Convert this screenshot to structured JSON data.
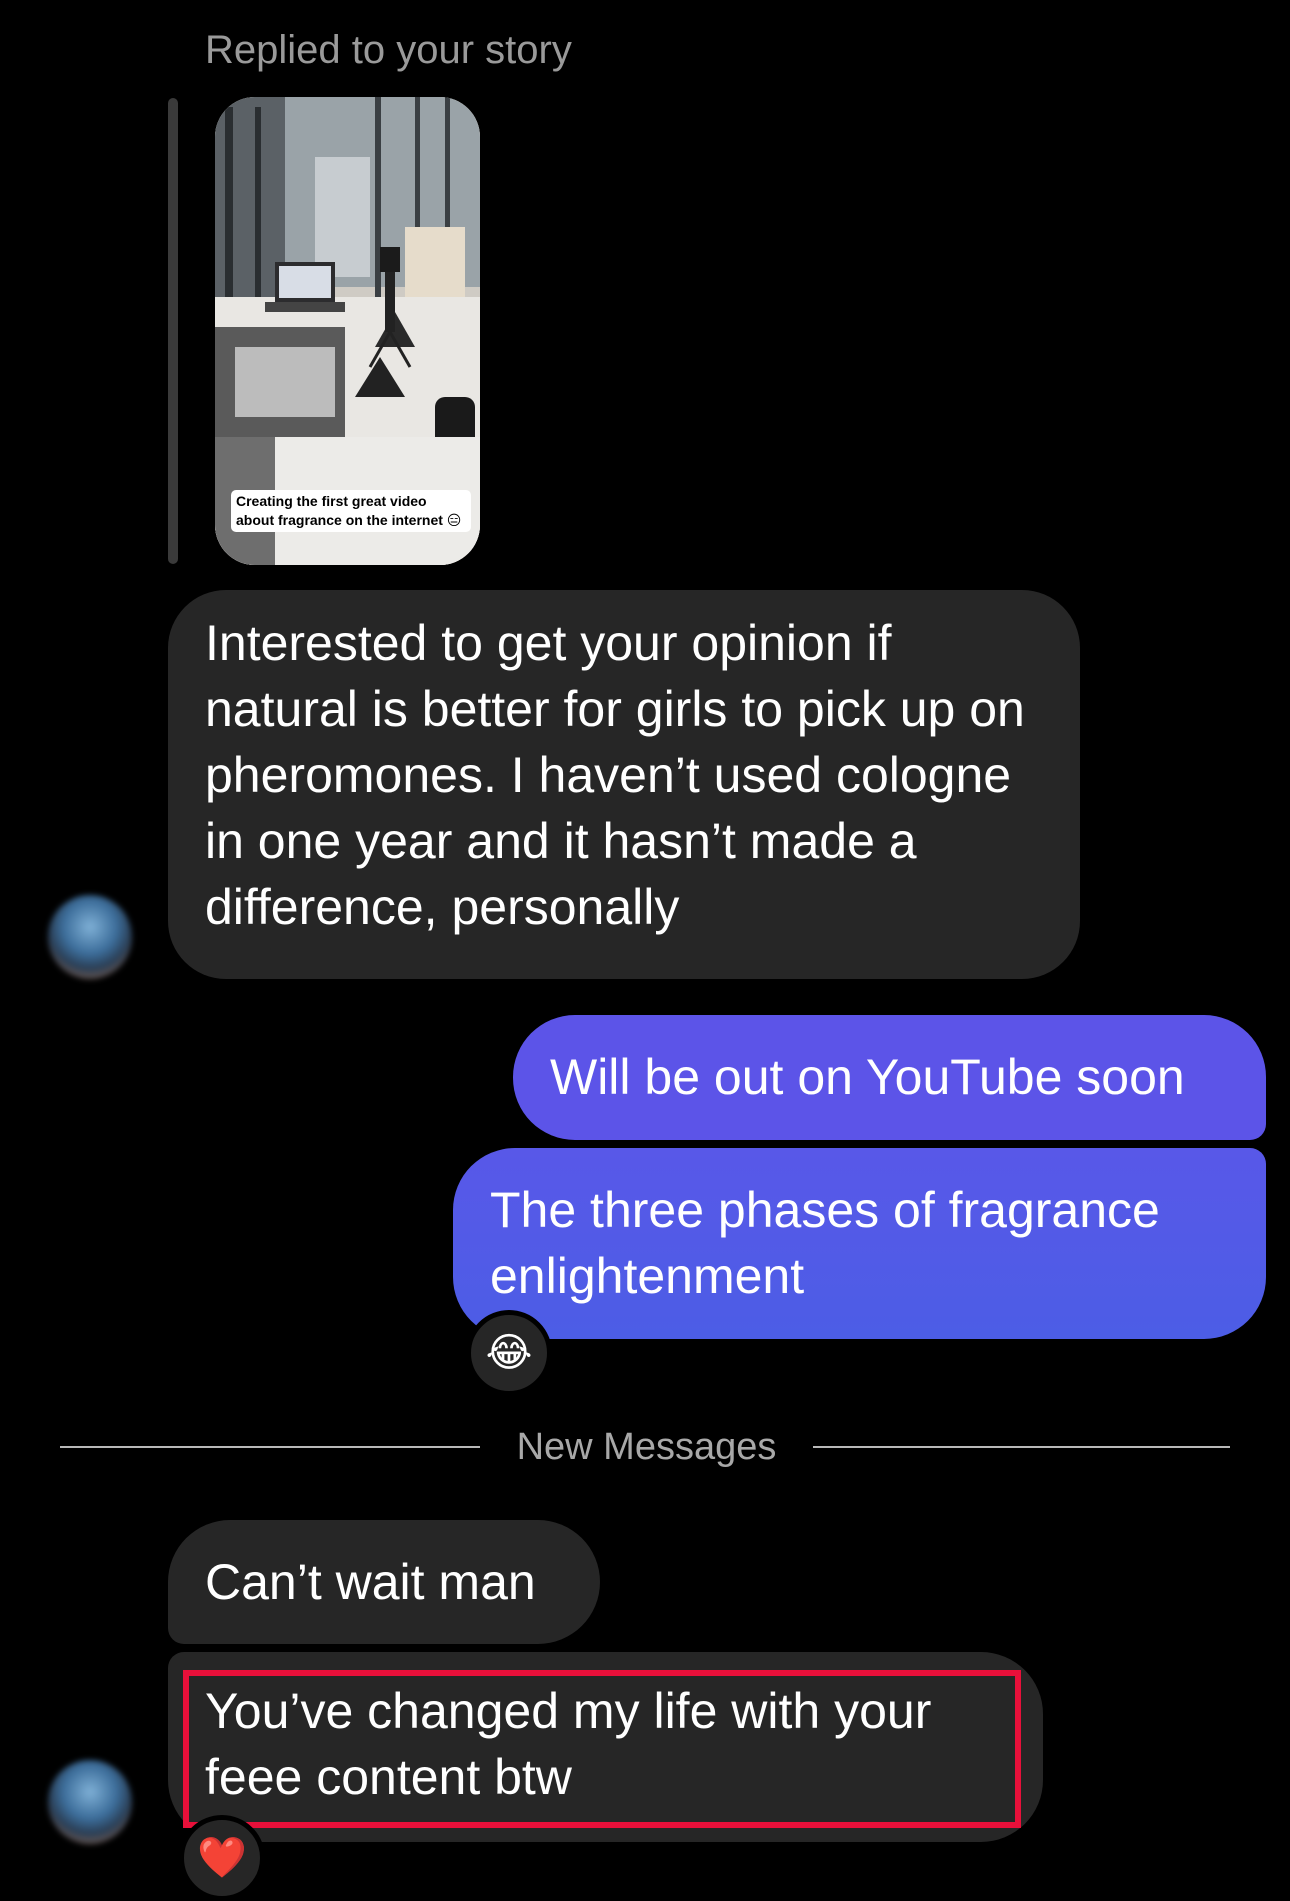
{
  "story_reply": {
    "caption": "Replied to your story",
    "thumbnail_caption": "Creating the first great video\nabout fragrance on the internet 😑"
  },
  "messages": [
    {
      "sender": "them",
      "text": "Interested to get your opinion if natural is better for girls to pick up on pheromones. I haven’t used cologne in one year and it hasn’t made a difference, personally"
    },
    {
      "sender": "me",
      "text": "Will be out on YouTube soon"
    },
    {
      "sender": "me",
      "text": "The three phases of fragrance enlightenment",
      "reaction": "😂"
    },
    {
      "sender": "them",
      "text": "Can’t wait man"
    },
    {
      "sender": "them",
      "text": "You’ve changed my life with your feee content btw",
      "reaction": "❤️"
    }
  ],
  "divider": {
    "label": "New Messages"
  },
  "colors": {
    "background": "#000000",
    "incoming_bubble": "#262626",
    "outgoing_bubble": "#5c54e8",
    "highlight": "#e8103a"
  },
  "icons": {
    "avatar": "contact-avatar-blurred",
    "laugh_reaction": "face-with-tears-of-joy-emoji",
    "heart_reaction": "red-heart-emoji"
  }
}
